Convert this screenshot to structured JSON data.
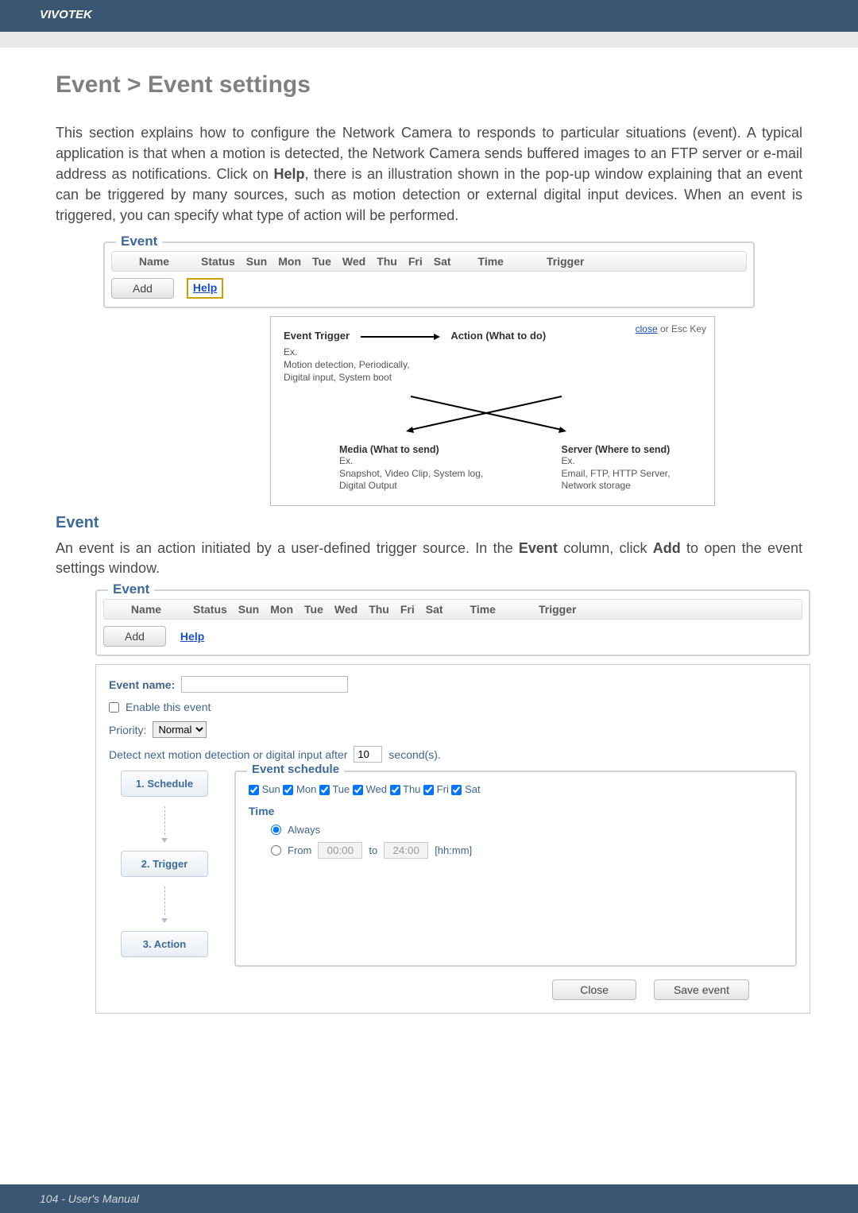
{
  "header_brand": "VIVOTEK",
  "title": "Event > Event settings",
  "intro_html": "This section explains how to configure the Network Camera to responds to particular situations (event). A typical application is that when a motion is detected, the Network Camera sends buffered images to an FTP server or e-mail address as notifications. Click on ",
  "intro_bold": "Help",
  "intro_tail": ", there is an illustration shown in the pop-up window explaining that an event can be triggered by many sources, such as motion detection or external digital input devices. When an event is triggered, you can specify what type of action will be performed.",
  "event_panel": {
    "legend": "Event",
    "cols": [
      "Name",
      "Status",
      "Sun",
      "Mon",
      "Tue",
      "Wed",
      "Thu",
      "Fri",
      "Sat",
      "Time",
      "Trigger"
    ],
    "add_label": "Add",
    "help_label": "Help"
  },
  "popup": {
    "close_link": "close",
    "close_rest": " or Esc Key",
    "et": "Event Trigger",
    "act": "Action (What to do)",
    "ex": "Ex.",
    "et_sub": "Motion detection, Periodically, Digital input, System boot",
    "media_hdr": "Media (What to send)",
    "media_sub": "Snapshot, Video Clip, System log, Digital Output",
    "server_hdr": "Server (Where to send)",
    "server_sub": "Email, FTP, HTTP Server, Network storage"
  },
  "section2": "Event",
  "para2_pre": "An event is an action initiated by a user-defined trigger source. In the ",
  "para2_b1": "Event",
  "para2_mid": " column, click ",
  "para2_b2": "Add",
  "para2_post": " to open the event settings window.",
  "form": {
    "event_name_label": "Event name:",
    "event_name_value": "",
    "enable_label": "Enable this event",
    "priority_label": "Priority:",
    "priority_value": "Normal",
    "detect_pre": "Detect next motion detection or digital input after",
    "detect_value": "10",
    "detect_post": "second(s).",
    "flow": [
      "1. Schedule",
      "2. Trigger",
      "3. Action"
    ],
    "sched_legend": "Event schedule",
    "days": [
      "Sun",
      "Mon",
      "Tue",
      "Wed",
      "Thu",
      "Fri",
      "Sat"
    ],
    "time_label": "Time",
    "always": "Always",
    "from": "From",
    "from_v": "00:00",
    "to": "to",
    "to_v": "24:00",
    "hhmm": "[hh:mm]",
    "close_btn": "Close",
    "save_btn": "Save event"
  },
  "footer": "104 - User's Manual"
}
